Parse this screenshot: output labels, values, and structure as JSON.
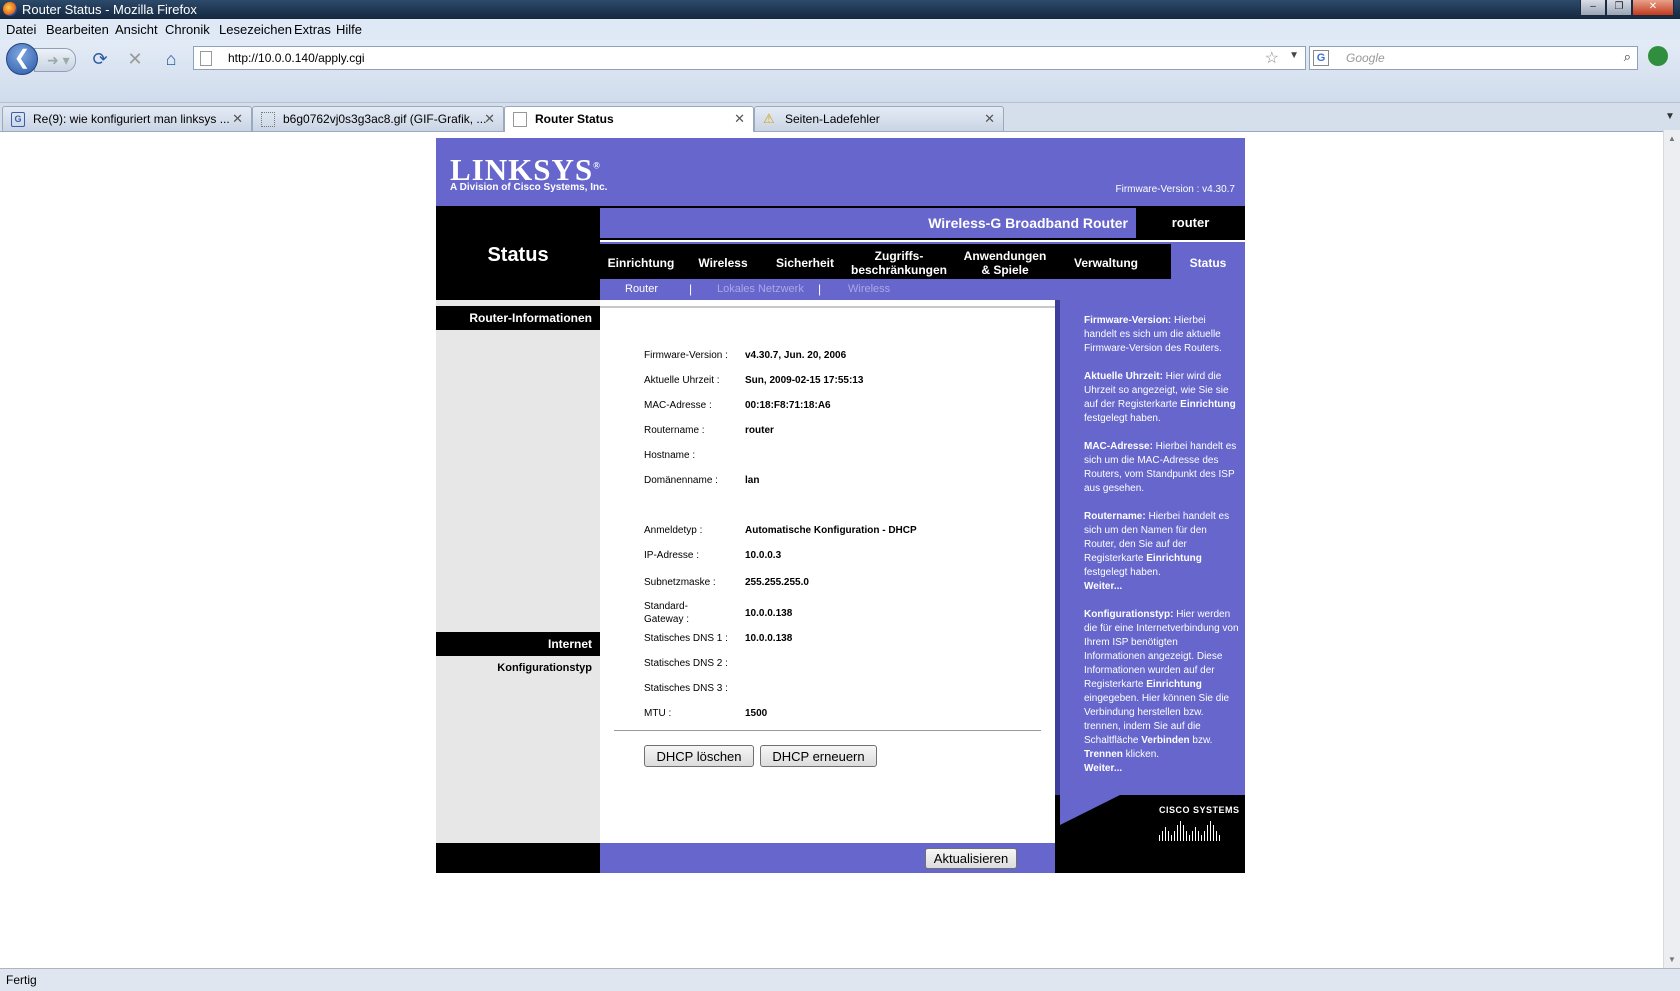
{
  "window": {
    "title": "Router Status - Mozilla Firefox",
    "buttons": [
      "‒",
      "❐",
      "✕"
    ]
  },
  "menu": [
    "Datei",
    "Bearbeiten",
    "Ansicht",
    "Chronik",
    "Lesezeichen",
    "Extras",
    "Hilfe"
  ],
  "nav": {
    "url": "http://10.0.0.140/apply.cgi",
    "search_placeholder": "Google",
    "icons": [
      "back-arrow-icon",
      "forward-arrow-icon",
      "reload-icon",
      "stop-icon",
      "home-icon",
      "bookmark-star-icon",
      "search-engine-icon",
      "magnifier-icon"
    ]
  },
  "tabs": [
    {
      "label": "Re(9): wie konfiguriert man linksys ...",
      "icon": "site-favicon"
    },
    {
      "label": "b6g0762vj0s3g3ac8.gif (GIF-Grafik, ...",
      "icon": "image-icon"
    },
    {
      "label": "Router Status",
      "icon": "page-icon",
      "active": true
    },
    {
      "label": "Seiten-Ladefehler",
      "icon": "warning-icon"
    }
  ],
  "status_bar": "Fertig",
  "router": {
    "logo": "LINKSYS",
    "logo_reg": "®",
    "logo_sub": "A Division of Cisco Systems, Inc.",
    "firmware_top": "Firmware-Version : v4.30.7",
    "product_name": "Wireless-G Broadband Router",
    "router_name": "router",
    "section_title": "Status",
    "main_nav": [
      "Einrichtung",
      "Wireless",
      "Sicherheit",
      "Zugriffs-\nbeschränkungen",
      "Anwendungen\n& Spiele",
      "Verwaltung",
      "Status"
    ],
    "sub_nav": [
      "Router",
      "Lokales Netzwerk",
      "Wireless"
    ],
    "sub_sep": "|",
    "left_sections": {
      "router_info": "Router-Informationen",
      "internet": "Internet",
      "config_type": "Konfigurationstyp"
    },
    "router_info_rows": [
      {
        "label": "Firmware-Version :",
        "value": "v4.30.7, Jun. 20, 2006"
      },
      {
        "label": "Aktuelle Uhrzeit :",
        "value": "Sun, 2009-02-15 17:55:13"
      },
      {
        "label": "MAC-Adresse :",
        "value": "00:18:F8:71:18:A6"
      },
      {
        "label": "Routername :",
        "value": "router"
      },
      {
        "label": "Hostname :",
        "value": ""
      },
      {
        "label": "Domänenname :",
        "value": "lan"
      }
    ],
    "internet_rows": [
      {
        "label": "Anmeldetyp :",
        "value": "Automatische Konfiguration - DHCP"
      },
      {
        "label": "IP-Adresse :",
        "value": "10.0.0.3"
      },
      {
        "label": "Subnetzmaske :",
        "value": "255.255.255.0"
      },
      {
        "label": "Standard-\nGateway :",
        "value": "10.0.0.138"
      },
      {
        "label": "Statisches DNS 1 :",
        "value": "10.0.0.138"
      },
      {
        "label": "Statisches DNS 2 :",
        "value": ""
      },
      {
        "label": "Statisches DNS 3 :",
        "value": ""
      },
      {
        "label": "MTU :",
        "value": "1500"
      }
    ],
    "buttons": {
      "dhcp_release": "DHCP löschen",
      "dhcp_renew": "DHCP erneuern",
      "refresh": "Aktualisieren"
    },
    "help": [
      {
        "title": "Firmware-Version:",
        "text": " Hierbei handelt es sich um die aktuelle Firmware-Version des Routers."
      },
      {
        "title": "Aktuelle Uhrzeit:",
        "text": " Hier wird die Uhrzeit so angezeigt, wie Sie sie auf der Registerkarte ",
        "bold2": "Einrichtung",
        "text2": " festgelegt haben."
      },
      {
        "title": "MAC-Adresse:",
        "text": " Hierbei handelt es sich um die MAC-Adresse des Routers, vom Standpunkt des ISP aus gesehen."
      },
      {
        "title": "Routername:",
        "text": " Hierbei handelt es sich um den Namen für den Router, den Sie auf der Registerkarte ",
        "bold2": "Einrichtung",
        "text2": " festgelegt haben.",
        "more": "Weiter..."
      },
      {
        "title": "Konfigurationstyp:",
        "text": " Hier werden die für eine Internetverbindung von Ihrem ISP benötigten Informationen angezeigt. Diese Informationen wurden auf der Registerkarte ",
        "bold2": "Einrichtung",
        "text2": " eingegeben. Hier können Sie die Verbindung herstellen bzw. trennen, indem Sie auf die Schaltfläche ",
        "bold3": "Verbinden",
        "text3": " bzw. ",
        "bold4": "Trennen",
        "text4": " klicken.",
        "more": "Weiter..."
      }
    ],
    "cisco_logo": "CISCO SYSTEMS",
    "colors": {
      "purple": "#6666cc",
      "black": "#000000",
      "gray": "#e7e7e7"
    }
  }
}
